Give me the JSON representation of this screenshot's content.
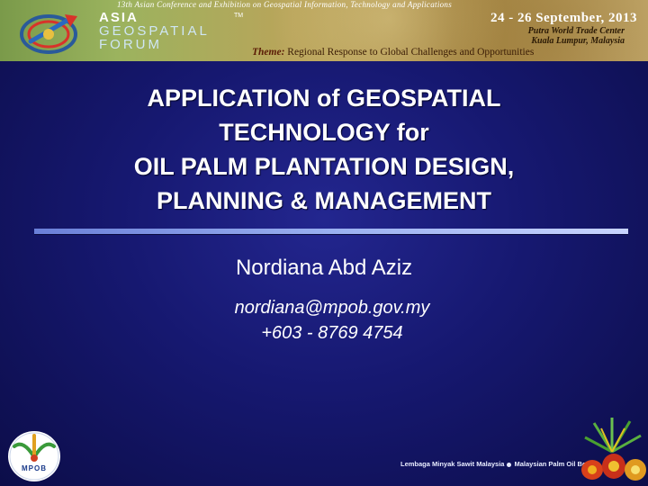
{
  "banner": {
    "conference_line": "13th Asian Conference and Exhibition on Geospatial Information, Technology and Applications",
    "forum_name_line1": "ASIA",
    "forum_name_line2": "GEOSPATIAL",
    "forum_name_line3": "FORUM",
    "trademark": "TM",
    "date": "24 - 26 September, 2013",
    "venue_line1": "Putra World Trade Center",
    "venue_line2": "Kuala Lumpur, Malaysia",
    "theme_label": "Theme:",
    "theme_text": "Regional Response to Global Challenges and Opportunities"
  },
  "title_lines": [
    "APPLICATION of GEOSPATIAL",
    "TECHNOLOGY for",
    "OIL PALM PLANTATION DESIGN,",
    "PLANNING & MANAGEMENT"
  ],
  "author": "Nordiana Abd Aziz",
  "email": "nordiana@mpob.gov.my",
  "phone": "+603 - 8769 4754",
  "footer": {
    "logo_text": "MPOB",
    "org_malay": "Lembaga Minyak Sawit Malaysia",
    "org_english": "Malaysian Palm Oil Board"
  },
  "colors": {
    "background": "#161870",
    "title_text": "#ffffff",
    "divider": "#9ab0f0",
    "banner_green": "#9bb35e",
    "banner_gold": "#b9a45a"
  },
  "icons": [
    "globe-arrow-logo-icon",
    "mpob-palm-logo-icon",
    "palm-fruit-art-icon"
  ]
}
